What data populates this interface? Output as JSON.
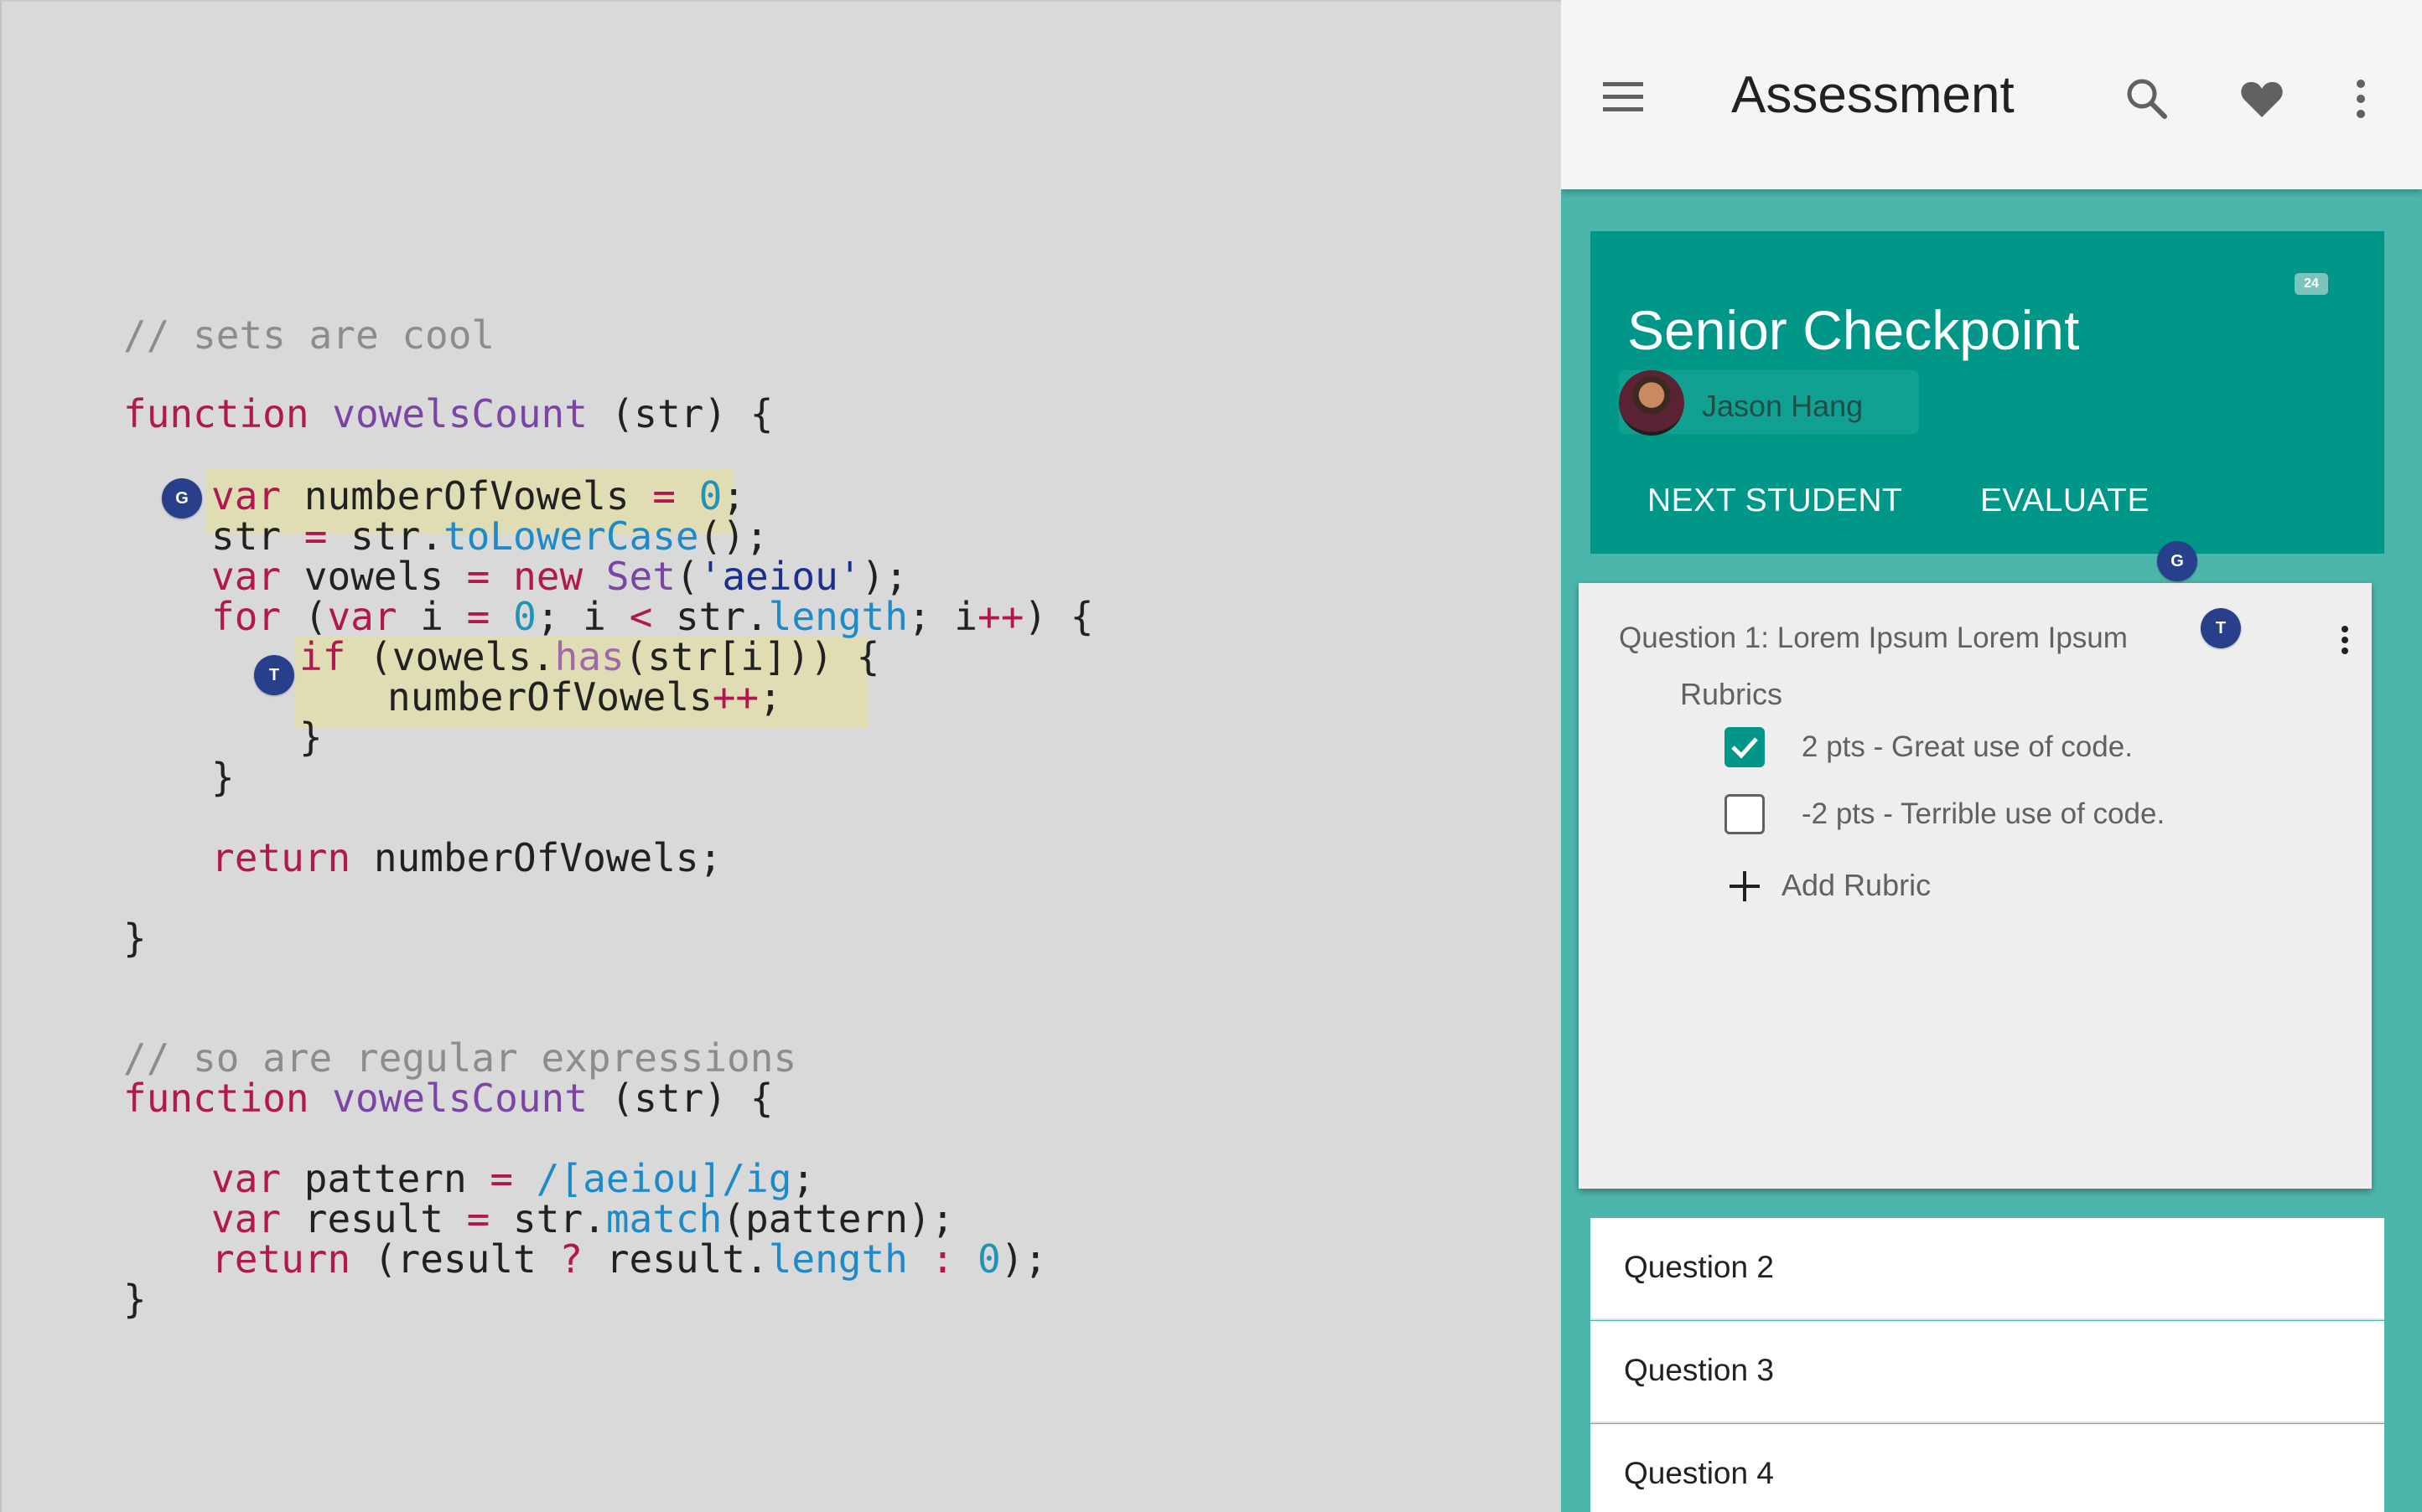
{
  "code_editor": {
    "lines": [
      {
        "tokens": [
          {
            "t": "// sets are cool",
            "c": "comment"
          }
        ]
      },
      {
        "tokens": [
          {
            "t": "function ",
            "c": "kw"
          },
          {
            "t": "vowelsCount",
            "c": "fn"
          },
          {
            "t": " (str) {",
            "c": "plain"
          }
        ]
      },
      {
        "tokens": [
          {
            "t": "var",
            "c": "kw"
          },
          {
            "t": " numberOfVowels ",
            "c": "plain"
          },
          {
            "t": "=",
            "c": "op"
          },
          {
            "t": " ",
            "c": "plain"
          },
          {
            "t": "0",
            "c": "num"
          },
          {
            "t": ";",
            "c": "plain"
          }
        ]
      },
      {
        "tokens": [
          {
            "t": "str ",
            "c": "plain"
          },
          {
            "t": "=",
            "c": "op"
          },
          {
            "t": " str.",
            "c": "plain"
          },
          {
            "t": "toLowerCase",
            "c": "prop"
          },
          {
            "t": "();",
            "c": "plain"
          }
        ]
      },
      {
        "tokens": [
          {
            "t": "var",
            "c": "kw"
          },
          {
            "t": " vowels ",
            "c": "plain"
          },
          {
            "t": "=",
            "c": "op"
          },
          {
            "t": " ",
            "c": "plain"
          },
          {
            "t": "new",
            "c": "kw"
          },
          {
            "t": " ",
            "c": "plain"
          },
          {
            "t": "Set",
            "c": "fn"
          },
          {
            "t": "(",
            "c": "plain"
          },
          {
            "t": "'aeiou'",
            "c": "str"
          },
          {
            "t": ");",
            "c": "plain"
          }
        ]
      },
      {
        "tokens": [
          {
            "t": "for",
            "c": "kw"
          },
          {
            "t": " (",
            "c": "plain"
          },
          {
            "t": "var",
            "c": "kw"
          },
          {
            "t": " i ",
            "c": "plain"
          },
          {
            "t": "=",
            "c": "op"
          },
          {
            "t": " ",
            "c": "plain"
          },
          {
            "t": "0",
            "c": "num"
          },
          {
            "t": "; i ",
            "c": "plain"
          },
          {
            "t": "<",
            "c": "op"
          },
          {
            "t": " str.",
            "c": "plain"
          },
          {
            "t": "length",
            "c": "prop"
          },
          {
            "t": "; i",
            "c": "plain"
          },
          {
            "t": "++",
            "c": "op"
          },
          {
            "t": ") {",
            "c": "plain"
          }
        ]
      },
      {
        "tokens": [
          {
            "t": "if",
            "c": "kw"
          },
          {
            "t": " (vowels.",
            "c": "plain"
          },
          {
            "t": "has",
            "c": "method"
          },
          {
            "t": "(str[i])) {",
            "c": "plain"
          }
        ]
      },
      {
        "tokens": [
          {
            "t": "numberOfVowels",
            "c": "plain"
          },
          {
            "t": "++",
            "c": "op"
          },
          {
            "t": ";",
            "c": "plain"
          }
        ]
      },
      {
        "tokens": [
          {
            "t": "}",
            "c": "plain"
          }
        ]
      },
      {
        "tokens": [
          {
            "t": "}",
            "c": "plain"
          }
        ]
      },
      {
        "tokens": [
          {
            "t": "return",
            "c": "kw"
          },
          {
            "t": " numberOfVowels;",
            "c": "plain"
          }
        ]
      },
      {
        "tokens": [
          {
            "t": "}",
            "c": "plain"
          }
        ]
      },
      {
        "tokens": [
          {
            "t": "// so are regular expressions",
            "c": "comment"
          }
        ]
      },
      {
        "tokens": [
          {
            "t": "function ",
            "c": "kw"
          },
          {
            "t": "vowelsCount",
            "c": "fn"
          },
          {
            "t": " (str) {",
            "c": "plain"
          }
        ]
      },
      {
        "tokens": [
          {
            "t": "var",
            "c": "kw"
          },
          {
            "t": " pattern ",
            "c": "plain"
          },
          {
            "t": "=",
            "c": "op"
          },
          {
            "t": " ",
            "c": "plain"
          },
          {
            "t": "/[aeiou]/ig",
            "c": "prop"
          },
          {
            "t": ";",
            "c": "plain"
          }
        ]
      },
      {
        "tokens": [
          {
            "t": "var",
            "c": "kw"
          },
          {
            "t": " result ",
            "c": "plain"
          },
          {
            "t": "=",
            "c": "op"
          },
          {
            "t": " str.",
            "c": "plain"
          },
          {
            "t": "match",
            "c": "prop"
          },
          {
            "t": "(pattern);",
            "c": "plain"
          }
        ]
      },
      {
        "tokens": [
          {
            "t": "return",
            "c": "kw"
          },
          {
            "t": " (result ",
            "c": "plain"
          },
          {
            "t": "?",
            "c": "op"
          },
          {
            "t": " result.",
            "c": "plain"
          },
          {
            "t": "length",
            "c": "prop"
          },
          {
            "t": " ",
            "c": "plain"
          },
          {
            "t": ":",
            "c": "op"
          },
          {
            "t": " ",
            "c": "plain"
          },
          {
            "t": "0",
            "c": "num"
          },
          {
            "t": ");",
            "c": "plain"
          }
        ]
      },
      {
        "tokens": [
          {
            "t": "}",
            "c": "plain"
          }
        ]
      }
    ],
    "comment_badges": [
      "G",
      "T"
    ]
  },
  "app": {
    "toolbar": {
      "title": "Assessment",
      "icons": [
        "menu-icon",
        "search-icon",
        "heart-icon",
        "more-vert-icon"
      ]
    },
    "assessment": {
      "title": "Senior Checkpoint",
      "count_badge": "24",
      "student_name": "Jason Hang",
      "actions": {
        "next_student": "NEXT STUDENT",
        "evaluate": "EVALUATE"
      },
      "card_badge": "G"
    },
    "question1": {
      "title": "Question 1: Lorem Ipsum Lorem Ipsum",
      "badge": "T",
      "rubrics_label": "Rubrics",
      "rubrics": [
        {
          "label": "2 pts - Great use of code.",
          "checked": true
        },
        {
          "label": "-2 pts - Terrible use of code.",
          "checked": false
        }
      ],
      "add_rubric": "Add Rubric"
    },
    "questions": [
      "Question 2",
      "Question 3",
      "Question 4"
    ]
  },
  "colors": {
    "primary": "#009688",
    "background_teal": "#4db6ac",
    "badge_blue": "#283f8c",
    "highlight": "#e0dcb3",
    "keyword": "#b3174f",
    "function": "#7b45a6"
  }
}
